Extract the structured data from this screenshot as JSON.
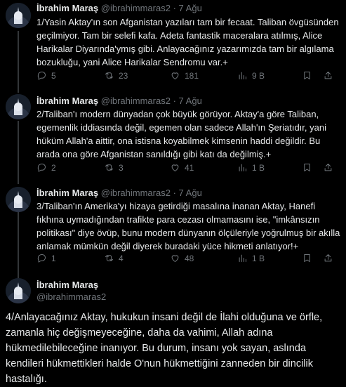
{
  "tweets": [
    {
      "name": "İbrahim Maraş",
      "handle": "@ibrahimmaras2",
      "sep": "·",
      "date": "7 Ağu",
      "lines": [
        "1/Yasin Aktay'ın son Afganistan yazıları tam bir fecaat. Taliban övgüsünden",
        "geçilmiyor. Tam bir selefi kafa. Adeta fantastik maceralara atılmış, Alice",
        "Harikalar Diyarında'ymış gibi. Anlayacağınız yazarımızda tam bir algılama",
        "bozukluğu, yani Alice Harikalar Sendromu var.+"
      ],
      "replies": "5",
      "reposts": "23",
      "likes": "181",
      "views": "9 B"
    },
    {
      "name": "İbrahim Maraş",
      "handle": "@ibrahimmaras2",
      "sep": "·",
      "date": "7 Ağu",
      "lines": [
        "2/Taliban'ı modern dünyadan çok büyük görüyor. Aktay'a göre Taliban,",
        "egemenlik iddiasında değil, egemen olan sadece Allah'ın Şeriatıdır, yani",
        "hüküm Allah'a aittir, ona istisna koyabilmek kimsenin haddi değildir. Bu",
        "arada ona göre Afganistan sanıldığı gibi katı da değilmiş.+"
      ],
      "replies": "2",
      "reposts": "3",
      "likes": "41",
      "views": "1 B"
    },
    {
      "name": "İbrahim Maraş",
      "handle": "@ibrahimmaras2",
      "sep": "·",
      "date": "7 Ağu",
      "lines": [
        "3/Taliban'ın Amerika'yı hizaya getirdiği masalına inanan Aktay, Hanefi",
        "fıkhına uymadığından trafikte para cezası olmamasını ise, \"imkânsızın",
        "politikası\" diye övüp, bunu modern dünyanın ölçüleriyle yoğrulmuş bir akılla",
        "anlamak mümkün değil diyerek buradaki yüce hikmeti anlatıyor!+"
      ],
      "replies": "1",
      "reposts": "4",
      "likes": "48",
      "views": "1 B"
    }
  ],
  "main": {
    "name": "İbrahim Maraş",
    "handle": "@ibrahimmaras2",
    "lines": [
      "4/Anlayacağınız Aktay, hukukun insani değil de İlahi olduğuna ve örfle,",
      "zamanla hiç değişmeyeceğine, daha da vahimi, Allah adına",
      "hükmedilebileceğine inanıyor. Bu durum, insanı yok sayan, aslında",
      "kendileri hükmettikleri halde O'nun hükmettiğini zanneden bir dincilik",
      "hastalığı."
    ]
  },
  "icons": {
    "reply": "reply-icon",
    "repost": "repost-icon",
    "like": "like-icon",
    "views": "views-icon",
    "bookmark": "bookmark-icon",
    "share": "share-icon"
  },
  "colors": {
    "background": "#000000",
    "text": "#e7e9ea",
    "muted": "#71767b",
    "thread_line": "#333639"
  }
}
